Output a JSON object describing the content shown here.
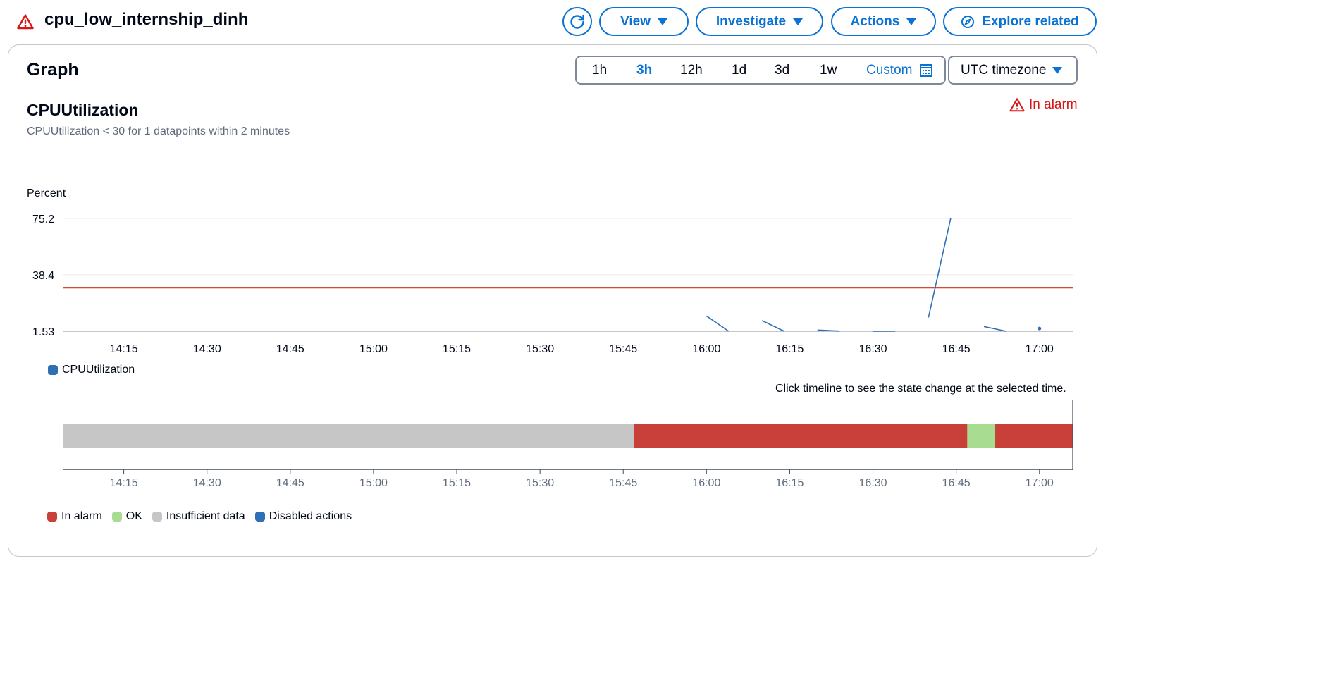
{
  "header": {
    "title": "cpu_low_internship_dinh",
    "buttons": {
      "view": "View",
      "investigate": "Investigate",
      "actions": "Actions",
      "explore": "Explore related"
    }
  },
  "card": {
    "title": "Graph",
    "ranges": [
      "1h",
      "3h",
      "12h",
      "1d",
      "3d",
      "1w"
    ],
    "active_range": "3h",
    "custom_label": "Custom",
    "timezone": "UTC timezone"
  },
  "metric": {
    "title": "CPUUtilization",
    "subtitle": "CPUUtilization < 30 for 1 datapoints within 2 minutes",
    "state": "In alarm"
  },
  "colors": {
    "accent": "#0972d3",
    "series": "#2f6fb5",
    "threshold": "#d13212",
    "in_alarm": "#c9403a",
    "ok": "#a8dc91",
    "insufficient": "#c6c6c6",
    "disabled": "#2f6fb5"
  },
  "chart_data": {
    "type": "line",
    "ylabel": "Percent",
    "y_ticks": [
      "75.2",
      "38.4",
      "1.53"
    ],
    "ylim": [
      1.53,
      75.2
    ],
    "x_ticks": [
      "14:15",
      "14:30",
      "14:45",
      "15:00",
      "15:15",
      "15:30",
      "15:45",
      "16:00",
      "16:15",
      "16:30",
      "16:45",
      "17:00"
    ],
    "xlim": [
      "14:04",
      "17:06"
    ],
    "threshold": 30,
    "series": [
      {
        "name": "CPUUtilization",
        "segments": [
          [
            [
              "16:00",
              11.5
            ],
            [
              "16:04",
              1.53
            ]
          ],
          [
            [
              "16:10",
              8.5
            ],
            [
              "16:14",
              1.53
            ]
          ],
          [
            [
              "16:20",
              2.3
            ],
            [
              "16:24",
              1.6
            ]
          ],
          [
            [
              "16:30",
              1.55
            ],
            [
              "16:34",
              1.6
            ]
          ],
          [
            [
              "16:40",
              10.5
            ],
            [
              "16:44",
              75.2
            ]
          ],
          [
            [
              "16:50",
              4.6
            ],
            [
              "16:54",
              1.53
            ]
          ]
        ],
        "points": [
          [
            "17:00",
            3.3
          ]
        ]
      }
    ],
    "timeline": {
      "hint": "Click timeline to see the state change at the selected time.",
      "segments": [
        {
          "state": "Insufficient data",
          "start": "14:04",
          "end": "15:47"
        },
        {
          "state": "In alarm",
          "start": "15:47",
          "end": "16:47"
        },
        {
          "state": "OK",
          "start": "16:47",
          "end": "16:52"
        },
        {
          "state": "In alarm",
          "start": "16:52",
          "end": "17:06"
        }
      ]
    },
    "legend": [
      "CPUUtilization"
    ],
    "state_legend": [
      "In alarm",
      "OK",
      "Insufficient data",
      "Disabled actions"
    ]
  }
}
